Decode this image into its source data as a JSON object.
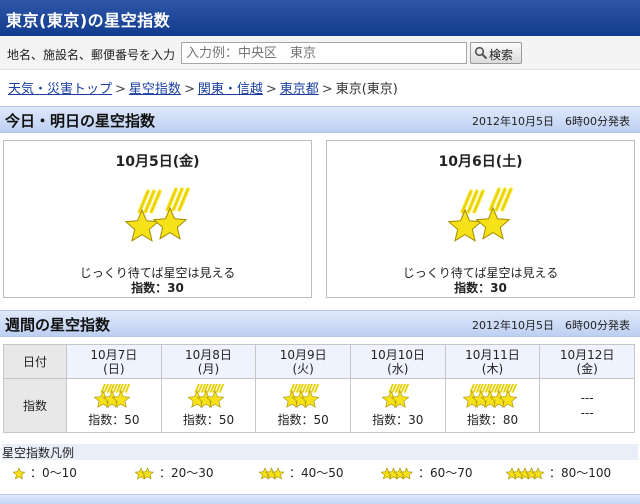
{
  "header": {
    "title": "東京(東京)の星空指数"
  },
  "search": {
    "label": "地名、施設名、郵便番号を入力",
    "placeholder": "入力例：中央区　東京",
    "button_label": "検索"
  },
  "breadcrumb": {
    "items": [
      "天気・災害トップ",
      "星空指数",
      "関東・信越",
      "東京都"
    ],
    "current": "東京(東京)"
  },
  "today": {
    "heading": "今日・明日の星空指数",
    "published": "2012年10月5日　6時00分発表",
    "days": [
      {
        "date": "10月5日(金)",
        "description": "じっくり待てば星空は見える",
        "index_text": "指数：30",
        "index": 30
      },
      {
        "date": "10月6日(土)",
        "description": "じっくり待てば星空は見える",
        "index_text": "指数：30",
        "index": 30
      }
    ]
  },
  "weekly": {
    "heading": "週間の星空指数",
    "published": "2012年10月5日　6時00分発表",
    "row_label_date": "日付",
    "row_label_index": "指数",
    "days": [
      {
        "date": "10月7日",
        "weekday": "(日)",
        "index_text": "指数：50",
        "index": 50
      },
      {
        "date": "10月8日",
        "weekday": "(月)",
        "index_text": "指数：50",
        "index": 50
      },
      {
        "date": "10月9日",
        "weekday": "(火)",
        "index_text": "指数：50",
        "index": 50
      },
      {
        "date": "10月10日",
        "weekday": "(水)",
        "index_text": "指数：30",
        "index": 30
      },
      {
        "date": "10月11日",
        "weekday": "(木)",
        "index_text": "指数：80",
        "index": 80
      },
      {
        "date": "10月12日",
        "weekday": "(金)",
        "index_text": "---",
        "index_text_2": "---",
        "index": null
      }
    ]
  },
  "legend": {
    "title": "星空指数凡例",
    "items": [
      {
        "range": "：0〜10",
        "stars": 1
      },
      {
        "range": "：20〜30",
        "stars": 2
      },
      {
        "range": "：40〜50",
        "stars": 3
      },
      {
        "range": "：60〜70",
        "stars": 4
      },
      {
        "range": "：80〜100",
        "stars": 5
      }
    ]
  },
  "colors": {
    "header": "#1e479a",
    "section": "#c9d8f4",
    "star": "#f7e21a",
    "star_outline": "#a38c00"
  },
  "icons": {
    "search": "magnifier-icon",
    "star": "star-icon"
  }
}
